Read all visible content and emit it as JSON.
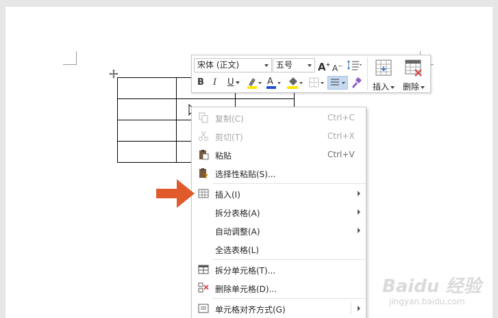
{
  "toolbar": {
    "font_name": "宋体 (正文)",
    "font_size": "五号",
    "bold": "B",
    "italic": "I",
    "underline": "U",
    "grow_font": "A",
    "shrink_font": "A",
    "font_color": "A",
    "insert_label": "插入",
    "delete_label": "删除"
  },
  "context_menu": {
    "items": [
      {
        "label": "复制(C)",
        "shortcut": "Ctrl+C",
        "icon": "copy-icon",
        "disabled": true
      },
      {
        "label": "剪切(T)",
        "shortcut": "Ctrl+X",
        "icon": "scissors-icon",
        "disabled": true
      },
      {
        "label": "粘贴",
        "shortcut": "Ctrl+V",
        "icon": "paste-icon",
        "disabled": false
      },
      {
        "label": "选择性粘贴(S)...",
        "shortcut": "",
        "icon": "paste-special-icon",
        "disabled": false
      },
      {
        "label": "插入(I)",
        "shortcut": "",
        "icon": "table-insert-icon",
        "submenu": true
      },
      {
        "label": "拆分表格(A)",
        "shortcut": "",
        "icon": "",
        "submenu": true
      },
      {
        "label": "自动调整(A)",
        "shortcut": "",
        "icon": "",
        "submenu": true
      },
      {
        "label": "全选表格(L)",
        "shortcut": "",
        "icon": ""
      },
      {
        "label": "拆分单元格(T)...",
        "shortcut": "",
        "icon": "split-cells-icon"
      },
      {
        "label": "删除单元格(D)...",
        "shortcut": "",
        "icon": "delete-cells-icon"
      },
      {
        "label": "单元格对齐方式(G)",
        "shortcut": "",
        "icon": "cell-align-icon",
        "submenu": true
      }
    ]
  },
  "watermark": {
    "logo": "Baidu 经验",
    "url": "jingyan.baidu.com"
  },
  "colors": {
    "arrow": "#e05a2b",
    "highlight_yellow": "#ffe600",
    "font_red": "#d9262c",
    "font_blue": "#1e4fd1",
    "delete_red": "#d83b3b"
  }
}
